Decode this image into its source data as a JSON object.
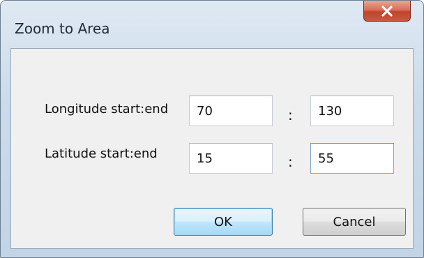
{
  "window": {
    "title": "Zoom to Area",
    "close_icon": "close-x-icon"
  },
  "longitude": {
    "label": "Longitude start:end",
    "start": "70",
    "separator": ":",
    "end": "130"
  },
  "latitude": {
    "label": "Latitude start:end",
    "start": "15",
    "separator": ":",
    "end": "55"
  },
  "buttons": {
    "ok": "OK",
    "cancel": "Cancel"
  },
  "colors": {
    "frame": "#cbdbea",
    "close_button": "#c8503a",
    "default_button": "#bee6fd",
    "client_area": "#f0f0f0"
  }
}
